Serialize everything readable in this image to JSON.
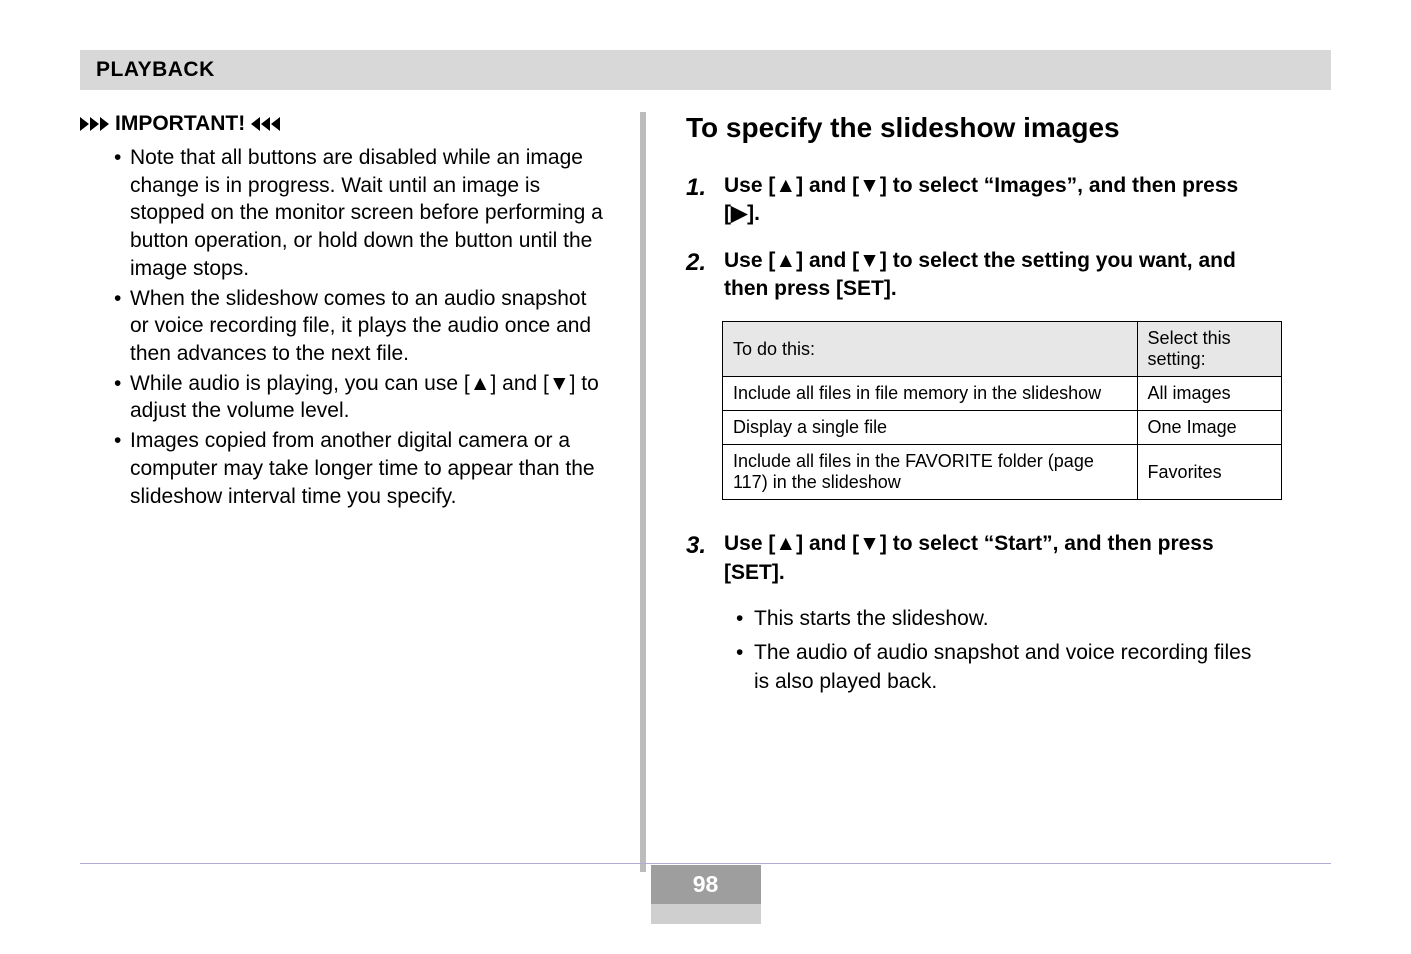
{
  "header": {
    "section": "PLAYBACK"
  },
  "important": {
    "label": "IMPORTANT!",
    "items": [
      "Note that all buttons are disabled while an image change is in progress. Wait until an image is stopped on the monitor screen before performing a button operation, or hold down the button until the image stops.",
      "When the slideshow comes to an audio snapshot or voice recording file, it plays the audio once and then advances to the next file.",
      "While audio is playing, you can use [▲] and [▼] to adjust the volume level.",
      "Images copied from another digital camera or a computer may take longer time to appear than the slideshow interval time you specify."
    ]
  },
  "right": {
    "heading": "To specify the slideshow images",
    "steps": {
      "s1": {
        "num": "1.",
        "text": "Use [▲] and [▼] to select “Images”, and then press [▶]."
      },
      "s2": {
        "num": "2.",
        "text": "Use [▲] and [▼] to select the setting you want, and then press [SET]."
      },
      "s3": {
        "num": "3.",
        "text": "Use [▲] and [▼] to select “Start”, and then press [SET]."
      }
    },
    "table": {
      "h1": "To do this:",
      "h2": "Select this setting:",
      "rows": [
        {
          "c1": "Include all files in file memory in the slideshow",
          "c2": "All images"
        },
        {
          "c1": "Display a single file",
          "c2": "One Image"
        },
        {
          "c1": "Include all files in the FAVORITE folder (page 117) in the slideshow",
          "c2": "Favorites"
        }
      ]
    },
    "sub": [
      "This starts the slideshow.",
      "The audio of audio snapshot and voice recording files is also played back."
    ]
  },
  "page": "98"
}
